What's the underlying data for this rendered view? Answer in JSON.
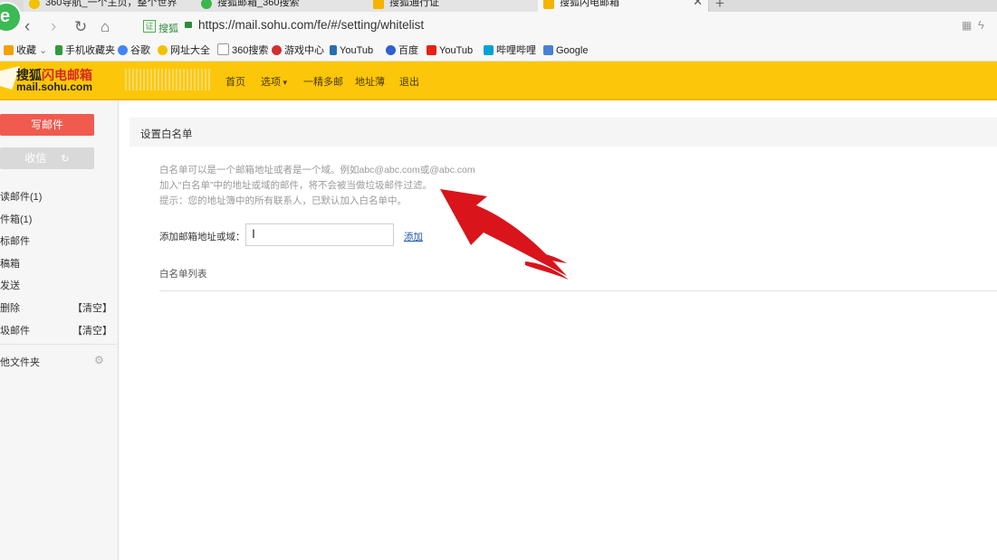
{
  "browser": {
    "tabs": [
      {
        "title": "360导航_一个主页，整个世界"
      },
      {
        "title": "搜狐邮箱_360搜索"
      },
      {
        "title": "搜狐通行证"
      },
      {
        "title": "搜狐闪电邮箱"
      }
    ],
    "site_badge": "搜狐",
    "url": "https://mail.sohu.com/fe/#/setting/whitelist",
    "bookmarks": [
      "收藏",
      "手机收藏夹",
      "谷歌",
      "网址大全",
      "360搜索",
      "游戏中心",
      "YouTub",
      "百度",
      "YouTub",
      "哔哩哔哩",
      "Google"
    ]
  },
  "header": {
    "logo_cn_a": "搜狐",
    "logo_cn_b": "闪电邮箱",
    "logo_domain": "mail.sohu.com",
    "menu": [
      "首页",
      "选项",
      "一精多邮",
      "地址薄",
      "退出"
    ]
  },
  "sidebar": {
    "compose": "写邮件",
    "receive": "收信",
    "folders": [
      "读邮件(1)",
      "件箱(1)",
      "标邮件",
      "稿箱",
      "发送",
      "删除",
      "圾邮件"
    ],
    "clear_label": "【清空】",
    "other": "他文件夹"
  },
  "main": {
    "title": "设置白名单",
    "hint1": "白名单可以是一个邮箱地址或者是一个域。例如abc@abc.com或@abc.com",
    "hint2": "加入“白名单”中的地址或域的邮件，将不会被当做垃圾邮件过滤。",
    "hint3": "提示：您的地址簿中的所有联系人，已默认加入白名单中。",
    "add_label": "添加邮箱地址或域：",
    "add_value": "",
    "add_button": "添加",
    "list_title": "白名单列表"
  },
  "colors": {
    "header": "#fcc70a",
    "compose": "#f05a4f",
    "arrow": "#d9141b"
  }
}
